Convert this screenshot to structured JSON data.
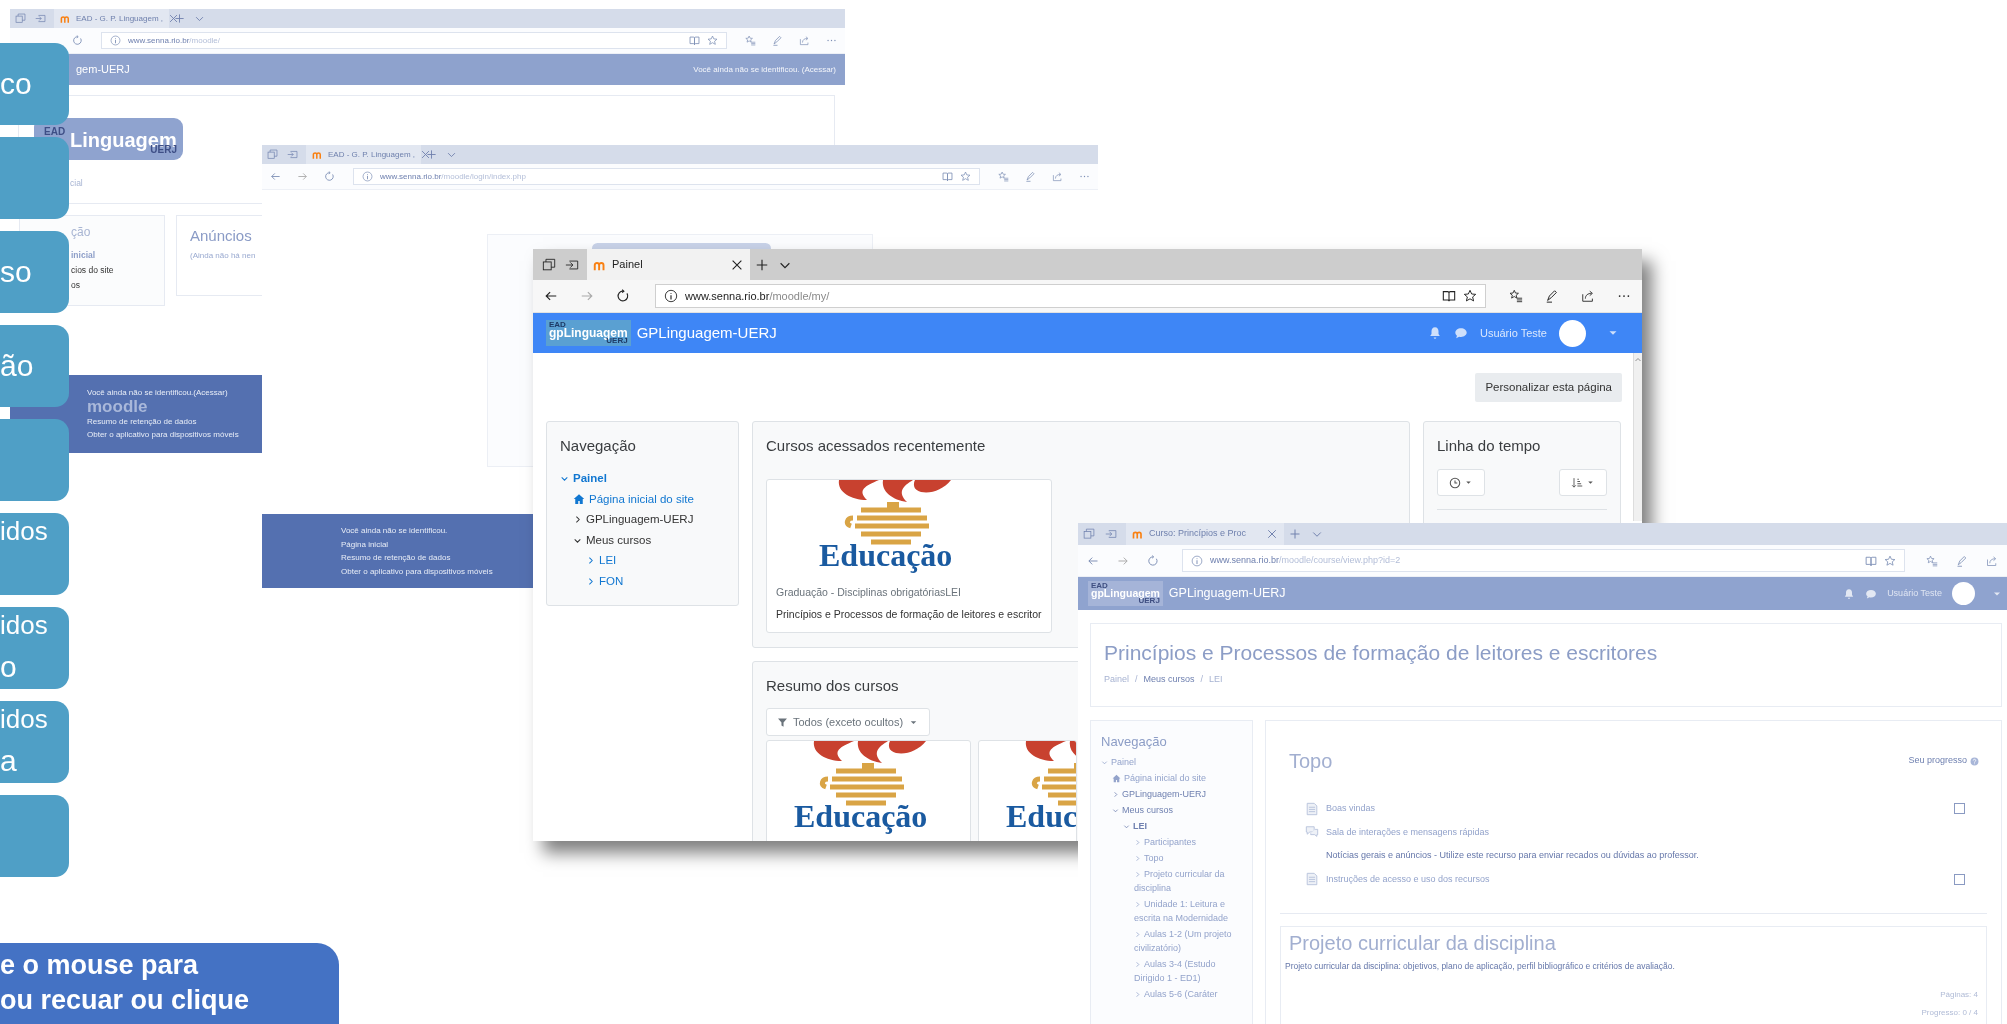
{
  "menu_tiles": [
    {
      "kind": "single",
      "lines": [
        "co"
      ]
    },
    {
      "kind": "blank"
    },
    {
      "kind": "single",
      "lines": [
        "so"
      ]
    },
    {
      "kind": "single",
      "lines": [
        "ão"
      ]
    },
    {
      "kind": "blank"
    },
    {
      "kind": "double",
      "lines": [
        "idos"
      ]
    },
    {
      "kind": "double",
      "lines": [
        "idos",
        "o"
      ]
    },
    {
      "kind": "double",
      "lines": [
        "idos",
        "a"
      ]
    },
    {
      "kind": "blank"
    }
  ],
  "windows": [
    {
      "kind": "home",
      "tab": "EAD - G. P. Linguagem ,",
      "url": {
        "host": "www.senna.rio.br",
        "path": "/moodle/"
      },
      "navbar": {
        "brand": "gem-UERJ",
        "notice": "Você ainda não se identificou. (Acessar)"
      },
      "logo": {
        "top": "EAD",
        "main": "Linguagem",
        "sub": "UERJ"
      },
      "breadcrumb": "cial",
      "navigation": {
        "title": "ção",
        "items": [
          {
            "label": "inicial",
            "current": true
          },
          {
            "label": "cios do site",
            "current": false
          },
          {
            "label": "os",
            "current": false
          }
        ]
      },
      "announcements": {
        "title": "Anúncios",
        "text": "(Ainda não há nen"
      },
      "footer": {
        "notice": "Você ainda não se identificou.",
        "login_link": "(Acessar)",
        "brand": "moodle",
        "links": [
          "Resumo de retenção de dados",
          "Obter o aplicativo para dispositivos móveis"
        ]
      }
    },
    {
      "kind": "login",
      "tab": "EAD - G. P. Linguagem ,",
      "url": {
        "host": "www.senna.rio.br",
        "path": "/moodle/login/index.php"
      },
      "footer": {
        "notice": "Você ainda não se identificou.",
        "links": [
          "Página inicial",
          "Resumo de retenção de dados",
          "Obter o aplicativo para dispositivos móveis"
        ]
      }
    },
    {
      "kind": "dashboard",
      "tab": "Painel",
      "url": {
        "host": "www.senna.rio.br",
        "path": "/moodle/my/"
      },
      "navbar": {
        "logo": {
          "top": "EAD",
          "main": "gpLinguagem",
          "sub": "UERJ"
        },
        "brand": "GPLinguagem-UERJ",
        "user": "Usuário Teste"
      },
      "customize_button": "Personalizar esta página",
      "navigation": {
        "title": "Navegação",
        "tree": [
          {
            "label": "Painel",
            "kind": "branch",
            "expanded": true,
            "link": true,
            "current": true,
            "children": [
              {
                "label": "Página inicial do site",
                "kind": "home",
                "link": true,
                "current": false
              },
              {
                "label": "GPLinguagem-UERJ",
                "kind": "branch",
                "expanded": false,
                "link": false,
                "current": false
              },
              {
                "label": "Meus cursos",
                "kind": "branch",
                "expanded": true,
                "link": false,
                "current": false,
                "children": [
                  {
                    "label": "LEI",
                    "kind": "branch",
                    "expanded": false,
                    "link": true,
                    "current": false
                  },
                  {
                    "label": "FON",
                    "kind": "branch",
                    "expanded": false,
                    "link": true,
                    "current": false
                  }
                ]
              }
            ]
          }
        ]
      },
      "recent_courses": {
        "title": "Cursos acessados recentemente",
        "courses": [
          {
            "image_text": "Educação",
            "category": "Graduação - Disciplinas obrigatóriasLEI",
            "name": "Princípios e Processos de formação de leitores e escritor"
          }
        ]
      },
      "timeline": {
        "title": "Linha do tempo"
      },
      "course_overview": {
        "title": "Resumo dos cursos",
        "filter": "Todos (exceto ocultos)",
        "courses": [
          {
            "image_text": "Educação"
          },
          {
            "image_text": "Educ"
          }
        ]
      }
    },
    {
      "kind": "course",
      "tab": "Curso: Princípios e Proc",
      "url": {
        "host": "www.senna.rio.br",
        "path": "/moodle/course/view.php?id=2"
      },
      "navbar": {
        "logo": {
          "top": "EAD",
          "main": "gpLinguagem",
          "sub": "UERJ"
        },
        "brand": "GPLinguagem-UERJ",
        "user": "Usuário Teste"
      },
      "header": {
        "title": "Princípios e Processos de formação de leitores e escritores",
        "breadcrumb": {
          "separator": "/",
          "items": [
            "Painel",
            "Meus cursos",
            "LEI"
          ]
        }
      },
      "navigation": {
        "title": "Navegação",
        "tree": [
          {
            "label": "Painel",
            "kind": "branch",
            "expanded": true,
            "link": true,
            "current": false,
            "children": [
              {
                "label": "Página inicial do site",
                "kind": "home",
                "link": true,
                "current": false
              },
              {
                "label": "GPLinguagem-UERJ",
                "kind": "branch",
                "expanded": false,
                "link": false,
                "current": false
              },
              {
                "label": "Meus cursos",
                "kind": "branch",
                "expanded": true,
                "link": false,
                "current": false,
                "children": [
                  {
                    "label": "LEI",
                    "kind": "branch",
                    "expanded": true,
                    "link": false,
                    "current": true,
                    "children": [
                      {
                        "label": "Participantes",
                        "kind": "branch",
                        "expanded": false,
                        "link": true,
                        "current": false
                      },
                      {
                        "label": "Topo",
                        "kind": "branch",
                        "expanded": false,
                        "link": true,
                        "current": false
                      },
                      {
                        "label": "Projeto curricular da disciplina",
                        "kind": "branch",
                        "expanded": false,
                        "link": true,
                        "current": false
                      },
                      {
                        "label": "Unidade 1: Leitura e escrita na Modernidade",
                        "kind": "branch",
                        "expanded": false,
                        "link": true,
                        "current": false
                      },
                      {
                        "label": "Aulas 1-2 (Um projeto civilizatório)",
                        "kind": "branch",
                        "expanded": false,
                        "link": true,
                        "current": false
                      },
                      {
                        "label": "Aulas 3-4 (Estudo Dirigido 1 - ED1)",
                        "kind": "branch",
                        "expanded": false,
                        "link": true,
                        "current": false
                      },
                      {
                        "label": "Aulas 5-6 (Caráter",
                        "kind": "branch",
                        "expanded": false,
                        "link": true,
                        "current": false
                      }
                    ]
                  }
                ]
              }
            ]
          }
        ]
      },
      "sections": [
        {
          "title": "Topo",
          "progress_label": "Seu progresso",
          "activities": [
            {
              "kind": "page",
              "label": "Boas vindas",
              "checked": false
            },
            {
              "kind": "forum",
              "label": "Sala de interações e mensagens rápidas"
            },
            {
              "kind": "note",
              "label": "Notícias gerais e anúncios -  Utilize este recurso para enviar recados ou dúvidas ao professor."
            },
            {
              "kind": "page",
              "label": "Instruções de acesso e uso dos recursos",
              "checked": false
            }
          ]
        },
        {
          "title": "Projeto curricular da disciplina",
          "summary": "Projeto curricular da disciplina: objetivos, plano de aplicação, perfil bibliográfico e critérios de avaliação.",
          "pages": "Páginas: 4",
          "progress": "Progresso: 0 / 4"
        }
      ]
    }
  ],
  "callout": {
    "lines": [
      "e o mouse para",
      "ou recuar ou clique"
    ]
  }
}
